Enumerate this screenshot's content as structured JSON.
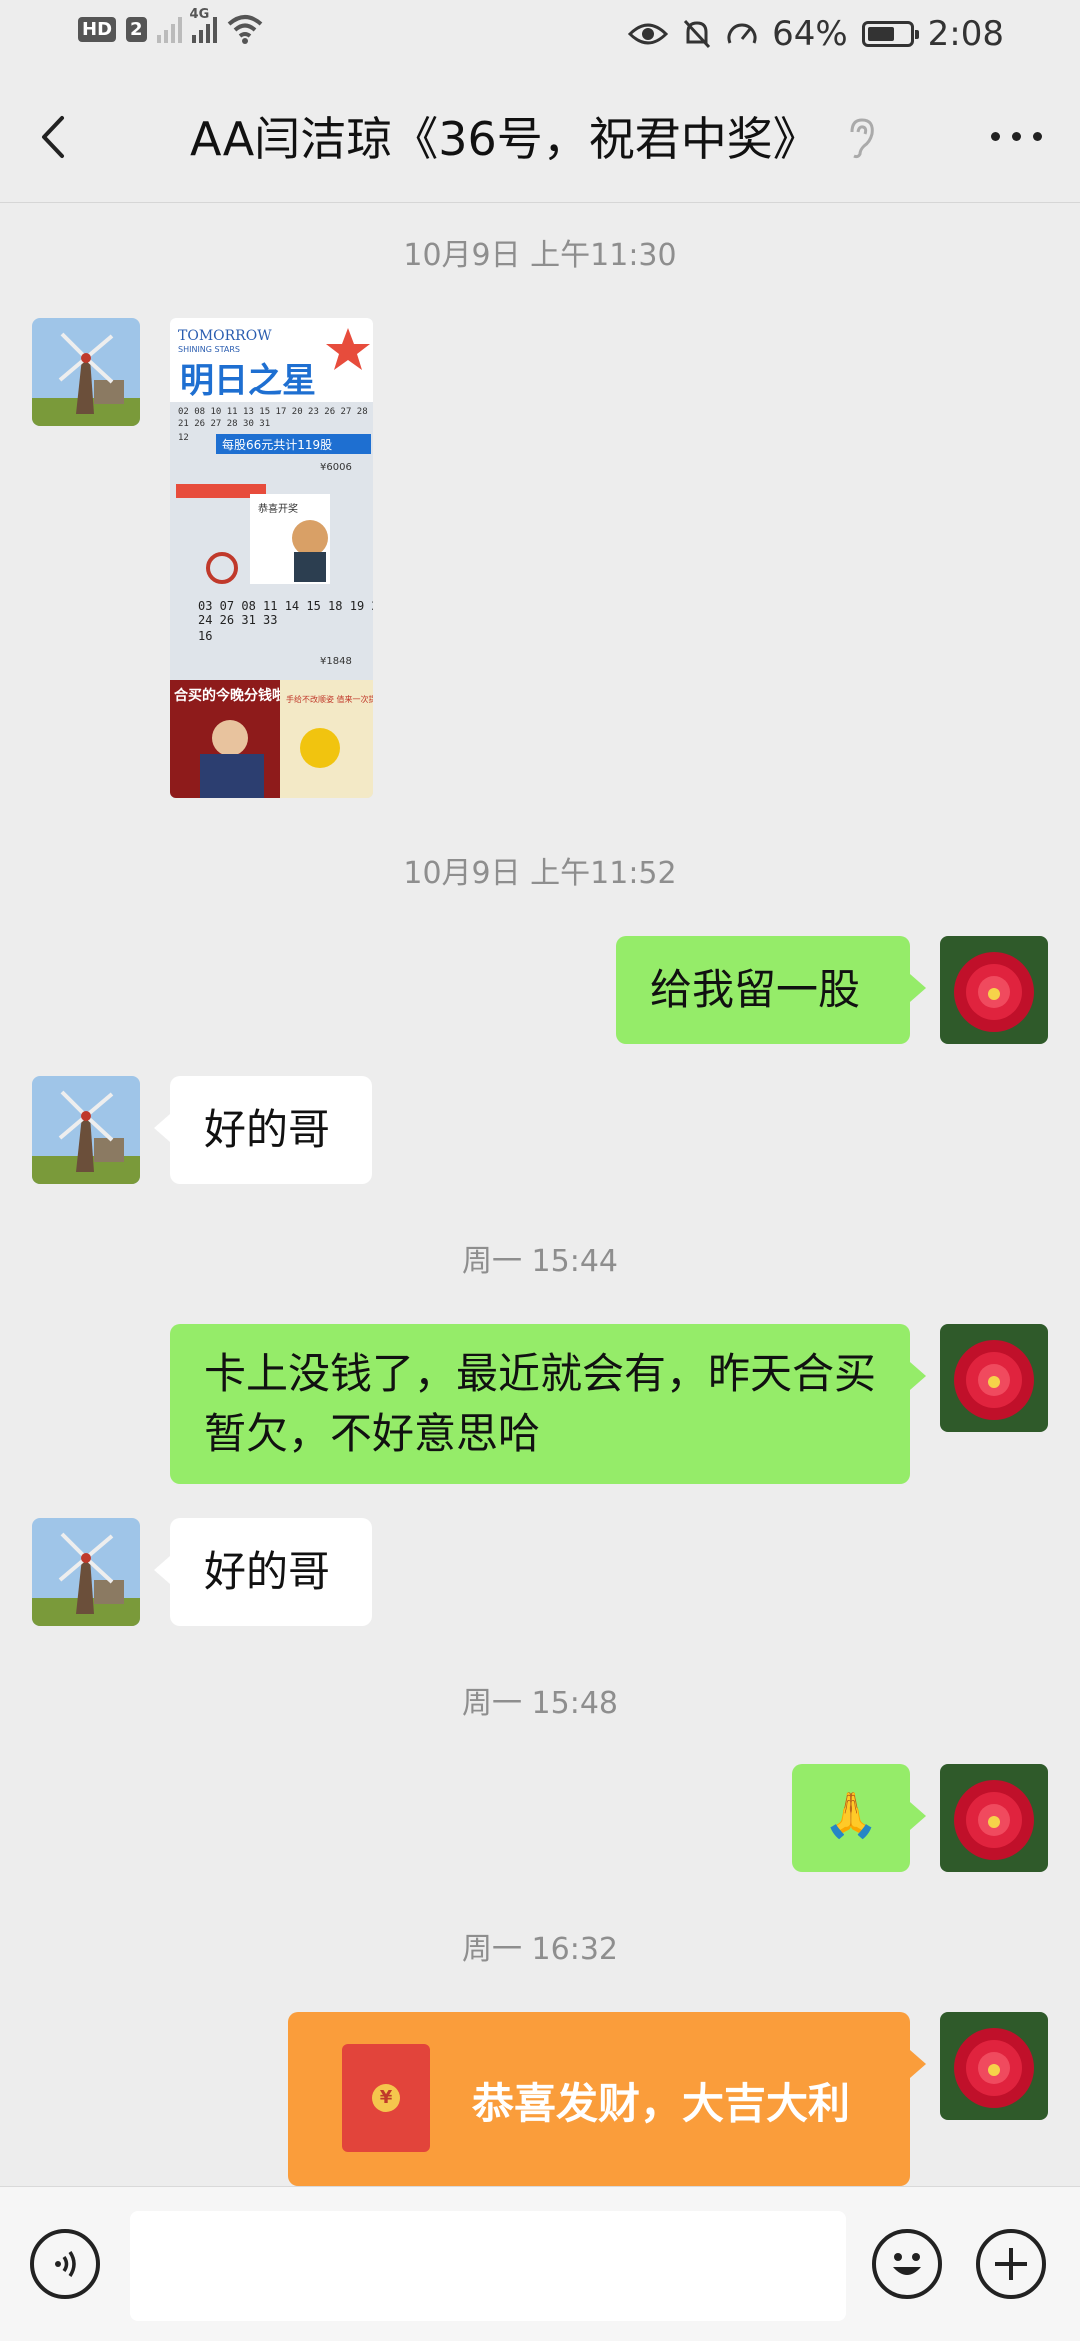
{
  "status_bar": {
    "network_badge": "HD",
    "sim_slot": "2",
    "network_type": "4G",
    "battery_percent": "64%",
    "battery_level": 0.64,
    "time": "2:08"
  },
  "header": {
    "title": "AA闫洁琼《36号，祝君中奖》",
    "icons": [
      "back-arrow-icon",
      "ear-icon",
      "more-icon"
    ]
  },
  "messages": [
    {
      "type": "time",
      "text": "10月9日 上午11:30"
    },
    {
      "type": "image",
      "from": "contact"
    },
    {
      "type": "time",
      "text": "10月9日 上午11:52"
    },
    {
      "type": "text",
      "from": "me",
      "text": "给我留一股"
    },
    {
      "type": "text",
      "from": "contact",
      "text": "好的哥"
    },
    {
      "type": "time",
      "text": "周一 15:44"
    },
    {
      "type": "text",
      "from": "me",
      "text": "卡上没钱了，最近就会有，昨天合买暂欠，不好意思哈"
    },
    {
      "type": "text",
      "from": "contact",
      "text": "好的哥"
    },
    {
      "type": "time",
      "text": "周一 15:48"
    },
    {
      "type": "emoji",
      "from": "me",
      "text": "🙏"
    },
    {
      "type": "time",
      "text": "周一 16:32"
    },
    {
      "type": "red_packet",
      "from": "me",
      "text": "恭喜发财，大吉大利",
      "icon_glyph": "¥"
    }
  ],
  "poster": {
    "brand_en": "TOMORROW",
    "brand_en_sub": "SHINING STARS",
    "brand_cn": "明日之星",
    "banner": "每股66元共计119股",
    "numbers_1": "02 08 10 11 13 15 17 20 23 26 27 28 30 31",
    "numbers_2": "03 07 08 11 14 15 18 19 24 26 31 33",
    "badge": "恭喜开奖",
    "amount_1": "¥6006",
    "amount_2": "¥1848",
    "caption_left": "合买的今晚分钱啦",
    "caption_right": "手给不改顺姿 值来一次提刀"
  },
  "input_bar": {
    "placeholder": "",
    "icons": [
      "voice-icon",
      "emoji-icon",
      "add-icon"
    ]
  },
  "colors": {
    "background": "#ededed",
    "bubble_out": "#95ec69",
    "bubble_in": "#ffffff",
    "red_packet": "#fa9d3b"
  }
}
